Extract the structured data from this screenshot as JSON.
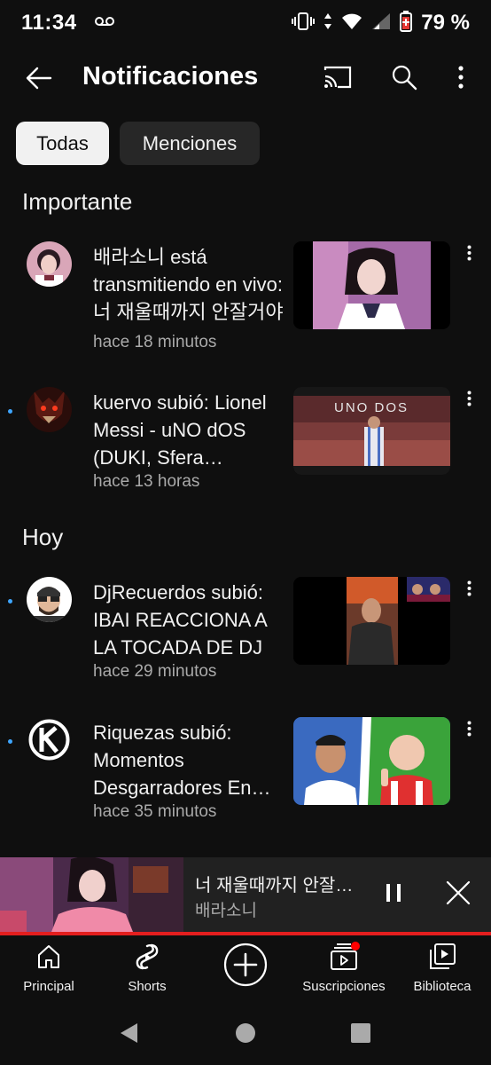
{
  "status_bar": {
    "time": "11:34",
    "battery": "79 %",
    "icons": [
      "voicemail-icon",
      "vibrate-icon",
      "data-arrows-icon",
      "wifi-icon",
      "signal-icon",
      "battery-saver-icon"
    ]
  },
  "header": {
    "title": "Notificaciones",
    "icons": [
      "back-arrow-icon",
      "cast-icon",
      "search-icon",
      "more-vert-icon"
    ]
  },
  "filters": {
    "all_label": "Todas",
    "mentions_label": "Menciones"
  },
  "sections": {
    "important": "Importante",
    "today": "Hoy"
  },
  "notifications": [
    {
      "title": "배라소니 está transmitiendo en vivo: 너 재울때까지 안잘거야",
      "time": "hace 18 minutos",
      "unread": false
    },
    {
      "title": "kuervo subió: Lionel Messi - uNO dOS (DUKI, Sfera Ebbasta)",
      "time": "hace 13 horas",
      "unread": true,
      "thumb_text": "UNO DOS"
    },
    {
      "title": "DjRecuerdos subió: IBAI REACCIONA A LA TOCADA DE DJ",
      "time": "hace 29 minutos",
      "unread": true
    },
    {
      "title": "Riquezas subió: Momentos Desgarradores En Vivo",
      "time": "hace 35 minutos",
      "unread": true
    }
  ],
  "mini_player": {
    "title": "너 재울때까지 안잘거야",
    "channel": "배라소니",
    "progress": 1.0
  },
  "bottom_nav": {
    "home": "Principal",
    "shorts": "Shorts",
    "subscriptions": "Suscripciones",
    "library": "Biblioteca"
  },
  "colors": {
    "background": "#0f0f0f",
    "chip_selected": "#f1f1f1",
    "chip_unselected": "#272727",
    "unread_dot": "#3ea6ff",
    "progress": "#e41e1e",
    "badge": "#ff0000",
    "secondary_text": "#aaaaaa"
  }
}
